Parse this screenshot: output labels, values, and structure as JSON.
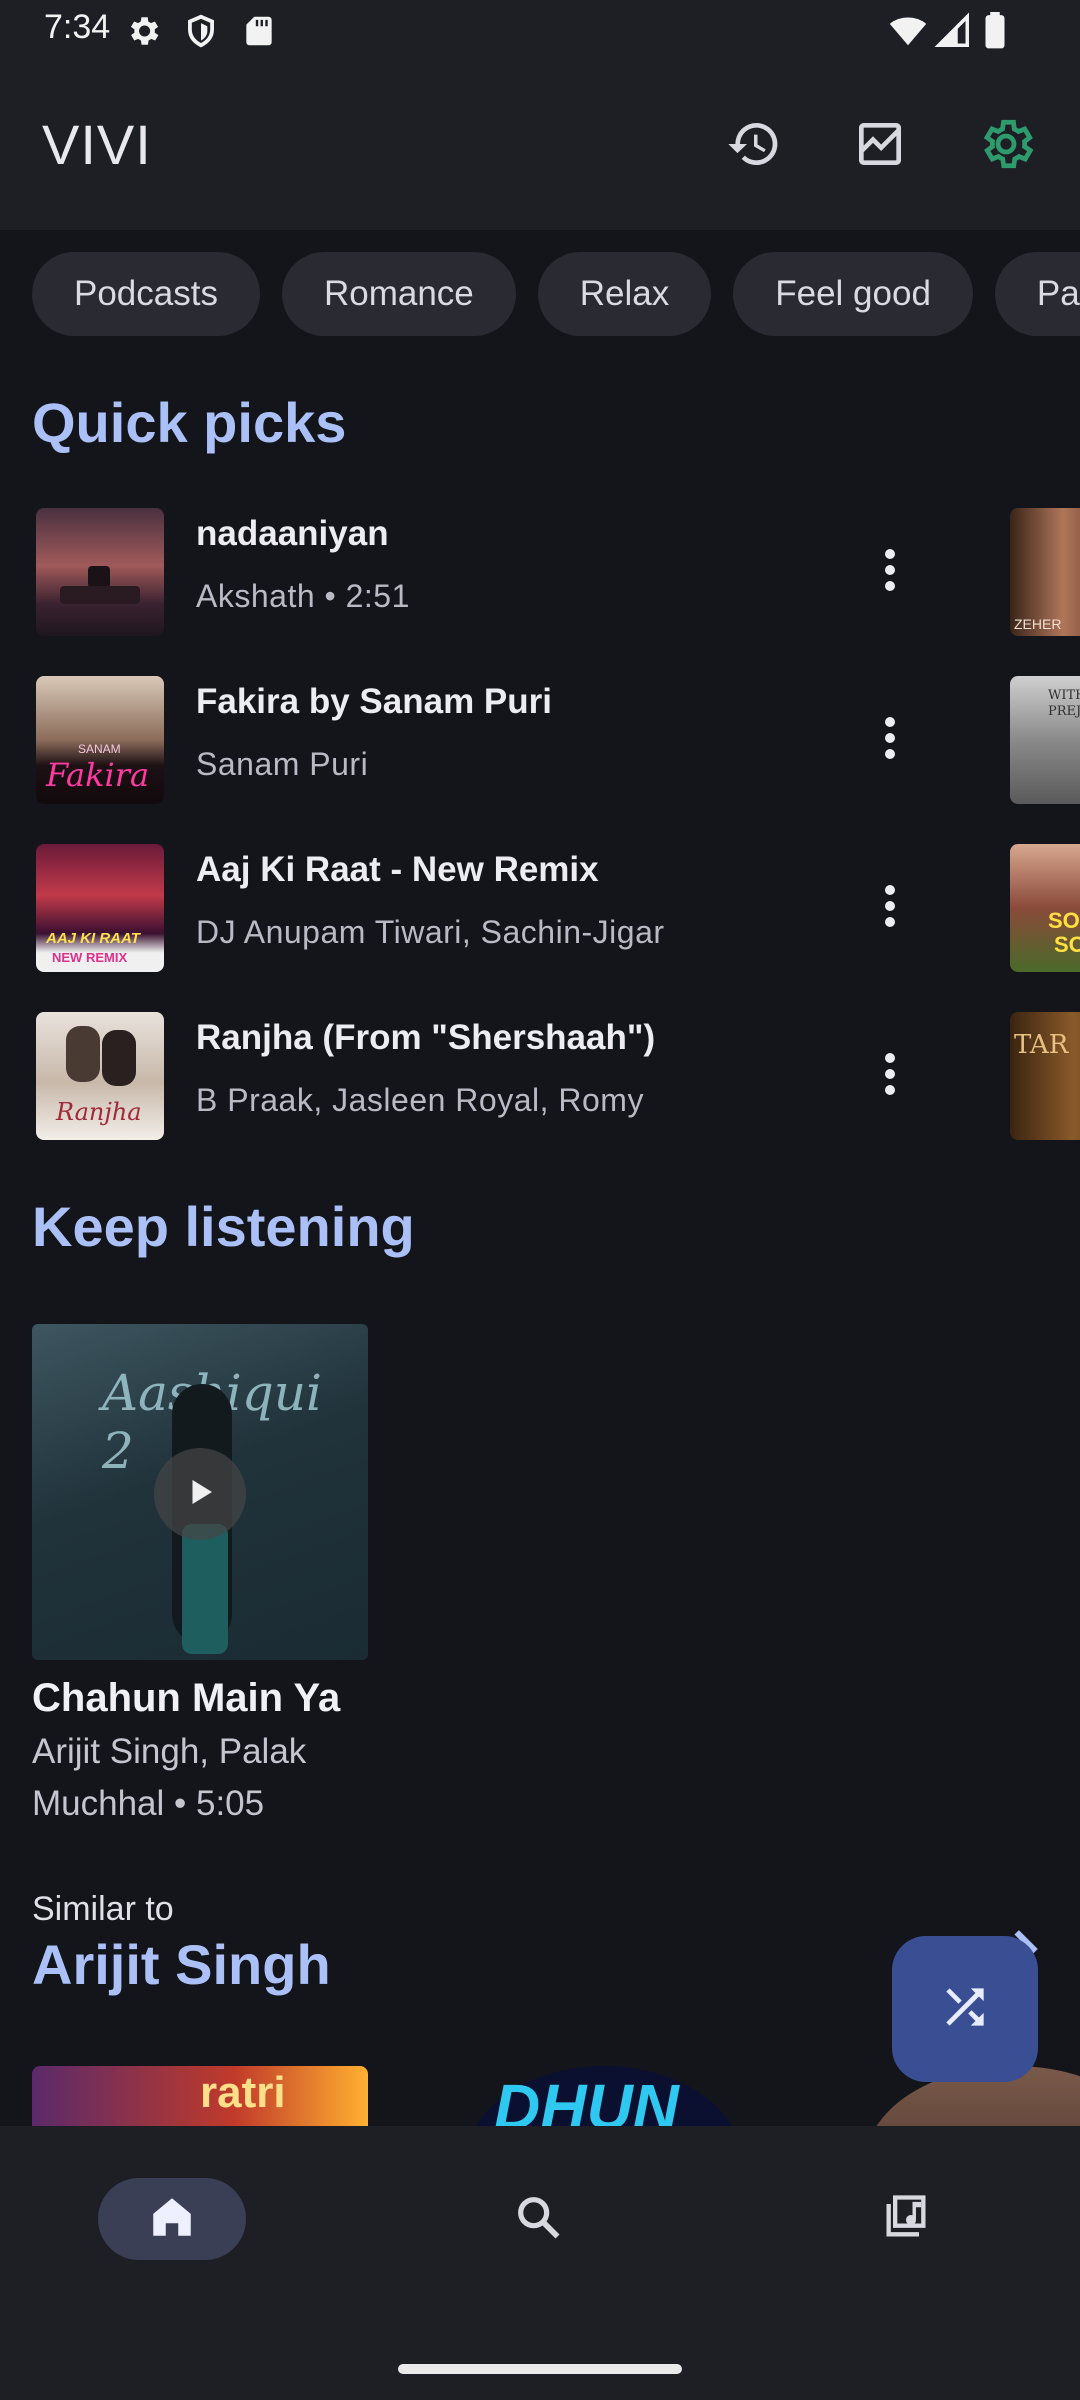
{
  "status_bar": {
    "time": "7:34",
    "left_icons": [
      "gear-icon",
      "shield-icon",
      "sd-card-icon"
    ],
    "right_icons": [
      "wifi-icon",
      "signal-icon",
      "battery-icon"
    ]
  },
  "app_bar": {
    "title": "VIVI",
    "actions": [
      "history-icon",
      "stats-icon",
      "settings-icon"
    ],
    "accent_color": "#2e9b6d"
  },
  "chips": [
    "Podcasts",
    "Romance",
    "Relax",
    "Feel good",
    "Pa"
  ],
  "quick_picks": {
    "title": "Quick picks",
    "items": [
      {
        "title": "nadaaniyan",
        "subtitle": "Akshath • 2:51"
      },
      {
        "title": "Fakira by Sanam Puri",
        "subtitle": "Sanam Puri"
      },
      {
        "title": "Aaj Ki Raat - New Remix",
        "subtitle": "DJ Anupam Tiwari, Sachin-Jigar"
      },
      {
        "title": "Ranjha (From \"Shershaah\")",
        "subtitle": "B Praak, Jasleen Royal, Romy"
      }
    ],
    "thumb_texts": {
      "fakira_small": "SANAM",
      "fakira": "Fakira",
      "aaj_ki_raat": "AAJ KI RAAT",
      "new_remix": "NEW REMIX",
      "ranjha": "Ranjha",
      "side_without": "WITHO",
      "side_prejud": "PREJU",
      "side_zehen": "ZEHER",
      "side_son": "SON",
      "side_so": "SO",
      "side_tar": "TAR"
    }
  },
  "keep_listening": {
    "title": "Keep listening",
    "album": {
      "title": "Chahun Main Ya",
      "subtitle": "Arijit Singh, Palak Muchhal • 5:05",
      "cover_text": "Aashiqui 2"
    }
  },
  "similar": {
    "label": "Similar to",
    "artist": "Arijit Singh",
    "strip_texts": [
      "ratri",
      "DHUN"
    ]
  },
  "nav": {
    "items": [
      "home-icon",
      "search-icon",
      "library-icon"
    ],
    "active": "home-icon"
  },
  "colors": {
    "background": "#14151b",
    "surface": "#1e1f25",
    "section_title": "#aac0f6",
    "fab": "#3a4f93"
  }
}
